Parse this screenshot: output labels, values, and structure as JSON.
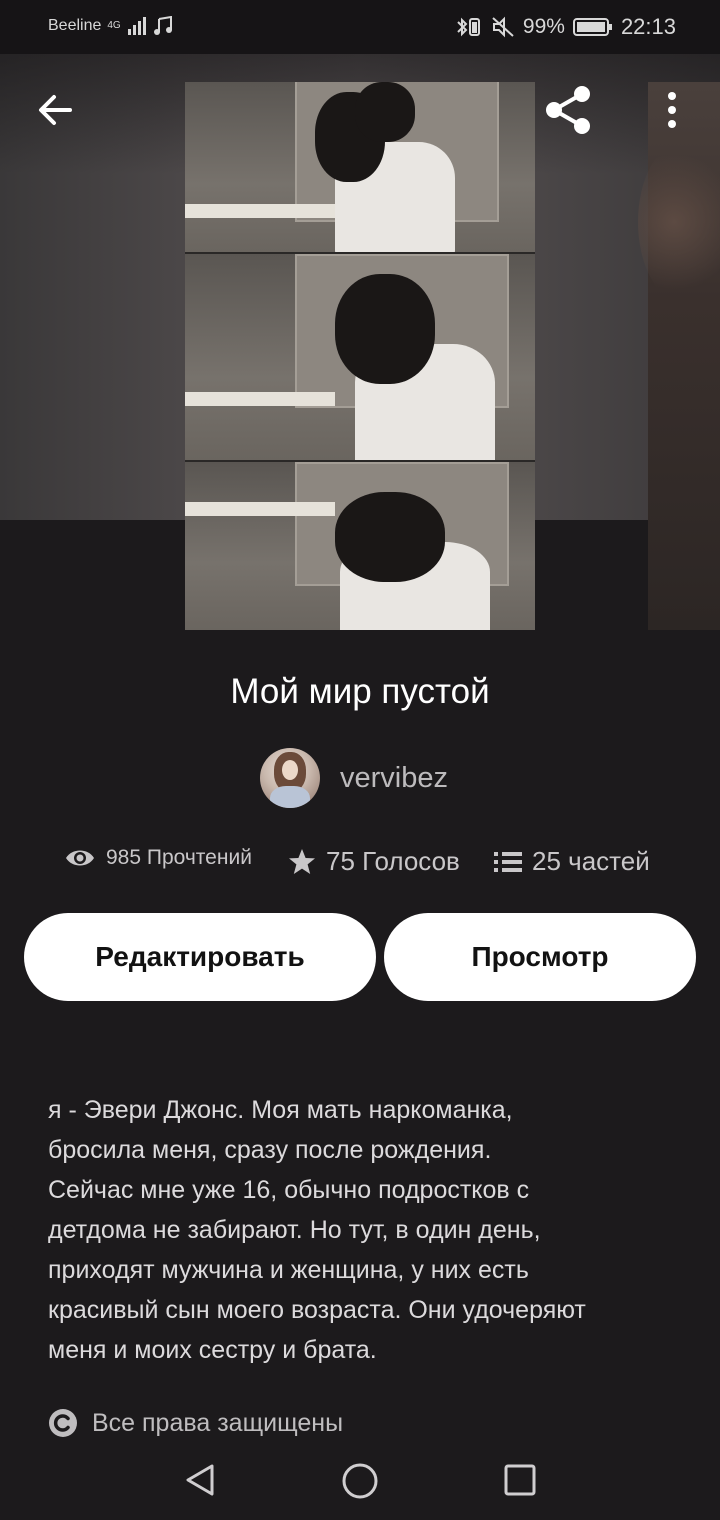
{
  "status_bar": {
    "carrier": "Beeline",
    "network": "4G",
    "battery": "99%",
    "time": "22:13"
  },
  "icons": {
    "back": "arrow-left-icon",
    "share": "share-icon",
    "more": "more-vertical-icon",
    "reads": "eye-icon",
    "votes": "star-icon",
    "parts": "list-icon",
    "copyright": "copyright-icon"
  },
  "story": {
    "title": "Мой мир пустой",
    "author": "vervibez",
    "stats": {
      "reads": "985 Прочтений",
      "votes": "75 Голосов",
      "parts": "25 частей"
    },
    "buttons": {
      "edit": "Редактировать",
      "view": "Просмотр"
    },
    "description": "я - Эвери Джонс. Моя мать наркоманка,\nбросила меня, сразу после рождения.\nСейчас мне уже 16, обычно подростков с\nдетдома не забирают. Но тут, в один день,\nприходят мужчина и женщина, у них есть\nкрасивый сын моего возраста. Они удочеряют\nменя и моих сестру и брата.",
    "rights": "Все права защищены"
  },
  "colors": {
    "background": "#1c1a1c",
    "button_bg": "#ffffff",
    "button_text": "#121212",
    "muted_text": "#c9c7c9"
  }
}
